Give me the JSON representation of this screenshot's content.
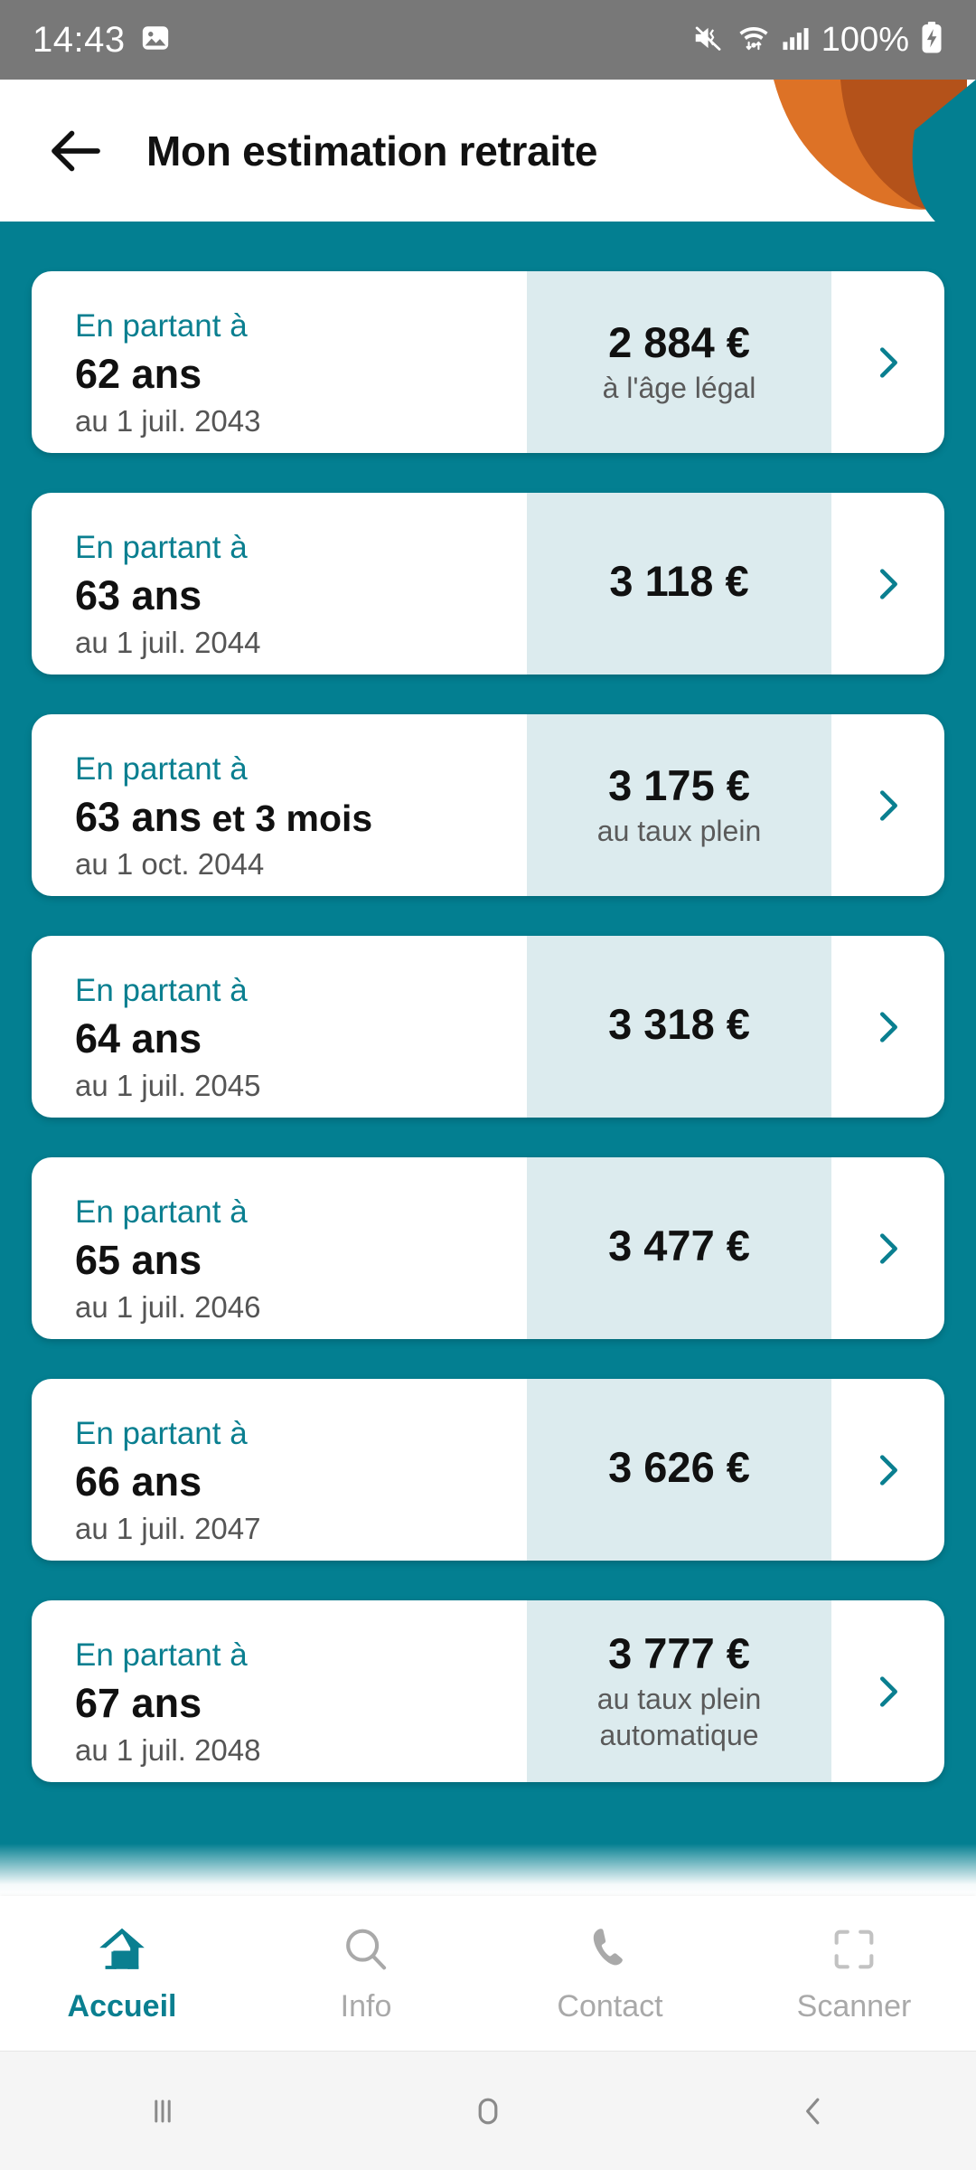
{
  "status_bar": {
    "time": "14:43",
    "battery_percent": "100%",
    "icons": [
      "screenshot-icon",
      "mute-vibrate-icon",
      "wifi-icon",
      "signal-icon",
      "battery-charging-icon"
    ]
  },
  "header": {
    "title": "Mon estimation retraite",
    "back_label": "back-arrow",
    "accent_orange_light": "#DD7226",
    "accent_orange_dark": "#B4521A",
    "teal": "#037F91"
  },
  "theme": {
    "teal": "#037F91",
    "teal_text": "#0A7F90",
    "amount_tint": "#DCEBEE",
    "card_white": "#FFFFFF",
    "muted_text": "#555555",
    "inactive_nav": "#A9A9A9"
  },
  "list": {
    "start_label": "En partant à",
    "cards": [
      {
        "age": "62 ans",
        "age_extra": "",
        "date": "au 1 juil. 2043",
        "amount": "2 884 €",
        "note": "à l'âge légal"
      },
      {
        "age": "63 ans",
        "age_extra": "",
        "date": "au 1 juil. 2044",
        "amount": "3 118 €",
        "note": ""
      },
      {
        "age": "63 ans",
        "age_extra": " et 3 mois",
        "date": "au 1 oct. 2044",
        "amount": "3 175 €",
        "note": "au taux plein"
      },
      {
        "age": "64 ans",
        "age_extra": "",
        "date": "au 1 juil. 2045",
        "amount": "3 318 €",
        "note": ""
      },
      {
        "age": "65 ans",
        "age_extra": "",
        "date": "au 1 juil. 2046",
        "amount": "3 477 €",
        "note": ""
      },
      {
        "age": "66 ans",
        "age_extra": "",
        "date": "au 1 juil. 2047",
        "amount": "3 626 €",
        "note": ""
      },
      {
        "age": "67 ans",
        "age_extra": "",
        "date": "au 1 juil. 2048",
        "amount": "3 777 €",
        "note": "au taux plein automatique"
      }
    ]
  },
  "bottom_nav": {
    "items": [
      {
        "label": "Accueil",
        "icon": "home-icon",
        "active": true
      },
      {
        "label": "Info",
        "icon": "search-icon",
        "active": false
      },
      {
        "label": "Contact",
        "icon": "phone-icon",
        "active": false
      },
      {
        "label": "Scanner",
        "icon": "scan-frame-icon",
        "active": false
      }
    ]
  },
  "system_nav": {
    "items": [
      {
        "name": "recents-button",
        "glyph": "|||"
      },
      {
        "name": "home-button",
        "glyph": "▢"
      },
      {
        "name": "back-button",
        "glyph": "‹"
      }
    ]
  }
}
